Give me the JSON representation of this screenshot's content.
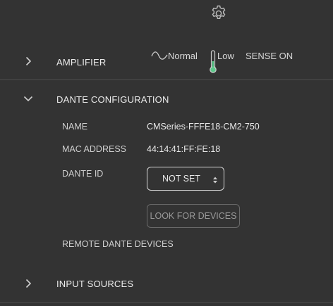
{
  "icons": {
    "settings": "gear-icon",
    "chevron_right": "chevron-right-icon",
    "chevron_down": "chevron-down-icon",
    "wave": "sine-wave-icon",
    "thermometer": "thermometer-icon",
    "select_arrows": "updown-arrows-icon"
  },
  "colors": {
    "background": "#333333",
    "thermometer_fill": "#5cc88a",
    "divider": "#4d4d4d"
  },
  "amplifier": {
    "label": "AMPLIFIER",
    "mode_normal": "Normal",
    "temp_low": "Low",
    "sense": "SENSE ON"
  },
  "dante": {
    "label": "DANTE CONFIGURATION",
    "name_label": "NAME",
    "name_value": "CMSeries-FFFE18-CM2-750",
    "mac_label": "MAC ADDRESS",
    "mac_value": "44:14:41:FF:FE:18",
    "id_label": "DANTE ID",
    "id_value": "NOT SET",
    "look_button": "LOOK FOR DEVICES",
    "remote_label": "REMOTE DANTE DEVICES"
  },
  "inputs": {
    "label": "INPUT SOURCES"
  }
}
